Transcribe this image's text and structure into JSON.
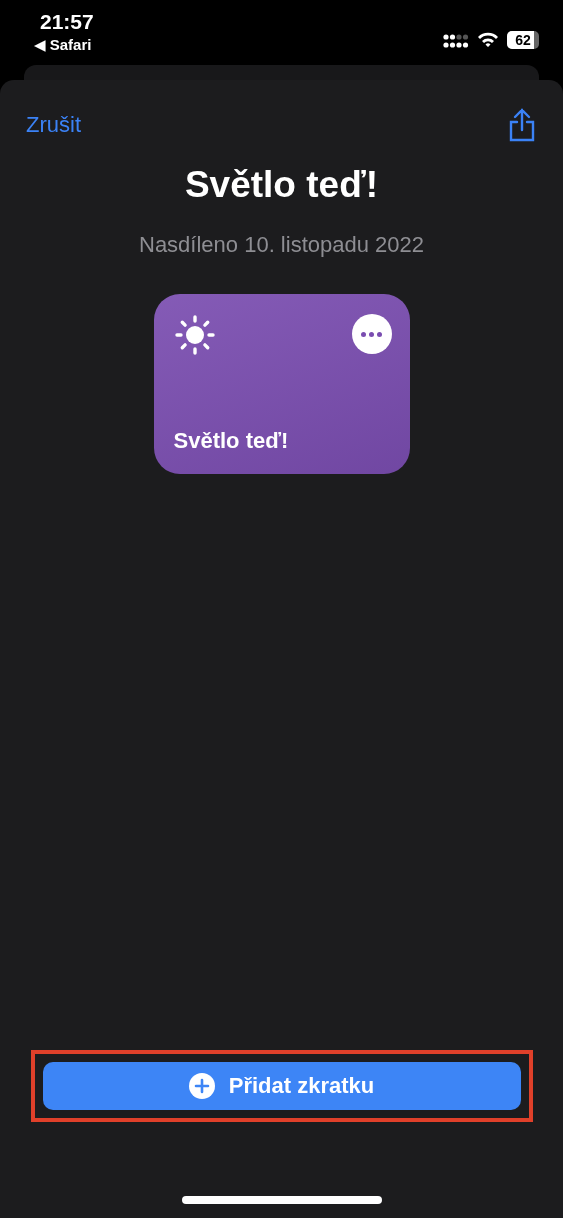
{
  "status_bar": {
    "time": "21:57",
    "back_link": "◀ Safari",
    "battery": "62"
  },
  "header": {
    "cancel": "Zrušit"
  },
  "title": "Světlo teď!",
  "subtitle": "Nasdíleno 10. listopadu 2022",
  "shortcut_card": {
    "title": "Světlo teď!",
    "color": "#7a4db0"
  },
  "add_button": {
    "label": "Přidat zkratku",
    "highlighted": true
  }
}
